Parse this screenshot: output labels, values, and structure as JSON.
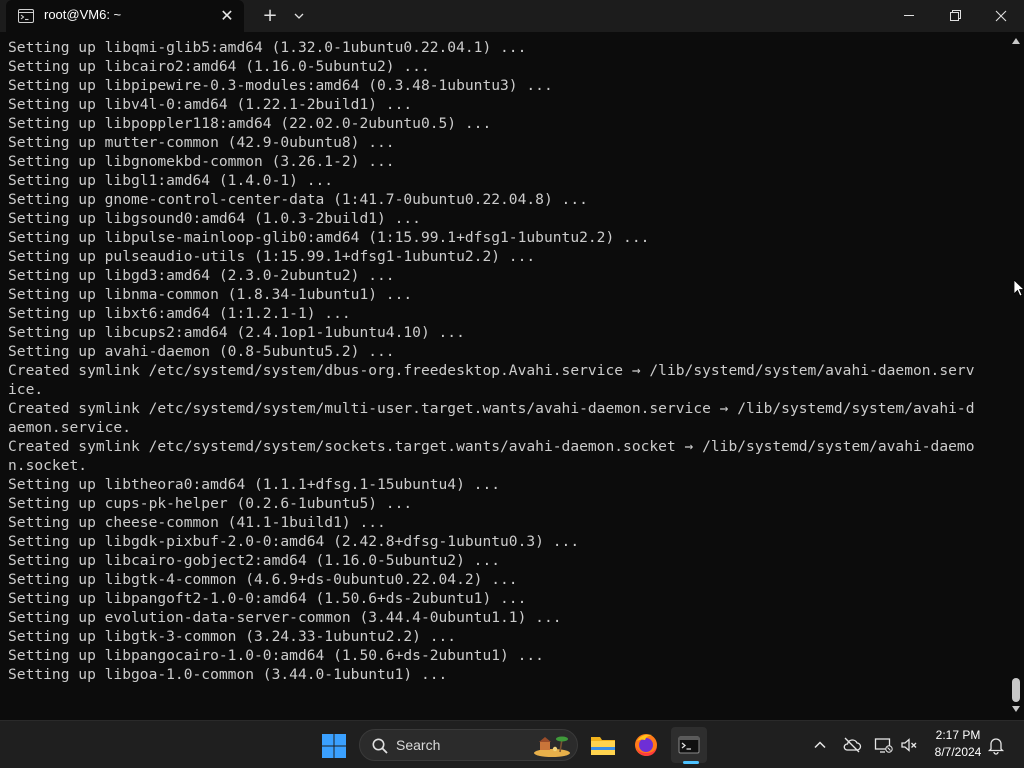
{
  "window": {
    "tab_title": "root@VM6: ~",
    "tab_close": "✕",
    "new_tab": "+",
    "colors": {
      "background": "#0c0c0c",
      "text": "#cccccc",
      "titlebar": "#1c1c1c"
    }
  },
  "terminal": {
    "lines": [
      "Setting up libqmi-glib5:amd64 (1.32.0-1ubuntu0.22.04.1) ...",
      "Setting up libcairo2:amd64 (1.16.0-5ubuntu2) ...",
      "Setting up libpipewire-0.3-modules:amd64 (0.3.48-1ubuntu3) ...",
      "Setting up libv4l-0:amd64 (1.22.1-2build1) ...",
      "Setting up libpoppler118:amd64 (22.02.0-2ubuntu0.5) ...",
      "Setting up mutter-common (42.9-0ubuntu8) ...",
      "Setting up libgnomekbd-common (3.26.1-2) ...",
      "Setting up libgl1:amd64 (1.4.0-1) ...",
      "Setting up gnome-control-center-data (1:41.7-0ubuntu0.22.04.8) ...",
      "Setting up libgsound0:amd64 (1.0.3-2build1) ...",
      "Setting up libpulse-mainloop-glib0:amd64 (1:15.99.1+dfsg1-1ubuntu2.2) ...",
      "Setting up pulseaudio-utils (1:15.99.1+dfsg1-1ubuntu2.2) ...",
      "Setting up libgd3:amd64 (2.3.0-2ubuntu2) ...",
      "Setting up libnma-common (1.8.34-1ubuntu1) ...",
      "Setting up libxt6:amd64 (1:1.2.1-1) ...",
      "Setting up libcups2:amd64 (2.4.1op1-1ubuntu4.10) ...",
      "Setting up avahi-daemon (0.8-5ubuntu5.2) ...",
      "Created symlink /etc/systemd/system/dbus-org.freedesktop.Avahi.service → /lib/systemd/system/avahi-daemon.serv",
      "ice.",
      "Created symlink /etc/systemd/system/multi-user.target.wants/avahi-daemon.service → /lib/systemd/system/avahi-d",
      "aemon.service.",
      "Created symlink /etc/systemd/system/sockets.target.wants/avahi-daemon.socket → /lib/systemd/system/avahi-daemo",
      "n.socket.",
      "Setting up libtheora0:amd64 (1.1.1+dfsg.1-15ubuntu4) ...",
      "Setting up cups-pk-helper (0.2.6-1ubuntu5) ...",
      "Setting up cheese-common (41.1-1build1) ...",
      "Setting up libgdk-pixbuf-2.0-0:amd64 (2.42.8+dfsg-1ubuntu0.3) ...",
      "Setting up libcairo-gobject2:amd64 (1.16.0-5ubuntu2) ...",
      "Setting up libgtk-4-common (4.6.9+ds-0ubuntu0.22.04.2) ...",
      "Setting up libpangoft2-1.0-0:amd64 (1.50.6+ds-2ubuntu1) ...",
      "Setting up evolution-data-server-common (3.44.4-0ubuntu1.1) ...",
      "Setting up libgtk-3-common (3.24.33-1ubuntu2.2) ...",
      "Setting up libpangocairo-1.0-0:amd64 (1.50.6+ds-2ubuntu1) ...",
      "Setting up libgoa-1.0-common (3.44.0-1ubuntu1) ..."
    ]
  },
  "taskbar": {
    "search_label": "Search",
    "clock_time": "2:17 PM",
    "clock_date": "8/7/2024",
    "apps": [
      "file-explorer-icon",
      "firefox-icon",
      "terminal-icon"
    ],
    "accent": "#4cc2ff"
  }
}
